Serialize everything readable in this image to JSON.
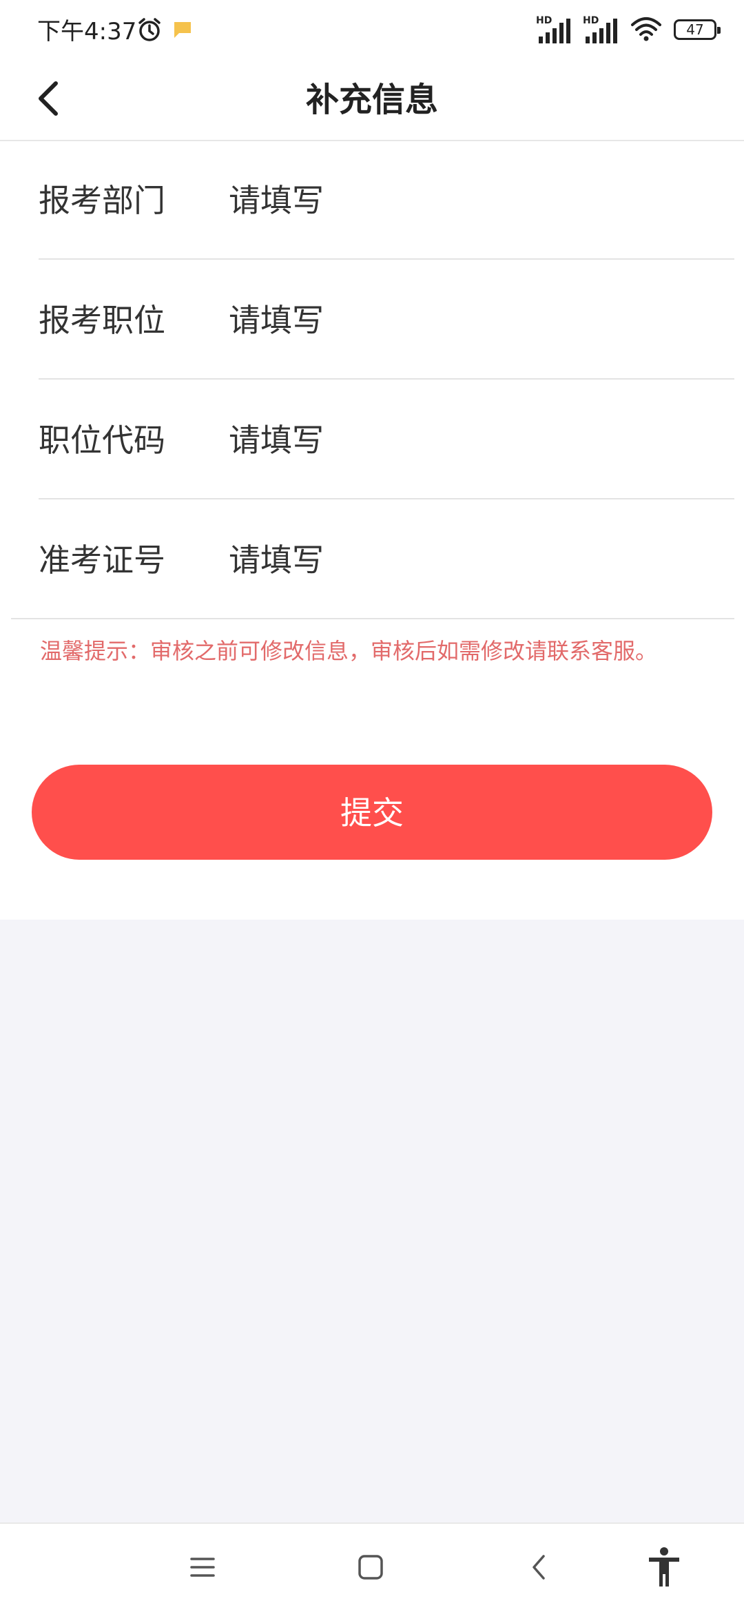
{
  "status_bar": {
    "time": "下午4:37",
    "battery": "47",
    "signal_1": "HD",
    "signal_2": "HD"
  },
  "header": {
    "title": "补充信息"
  },
  "form": {
    "fields": [
      {
        "label": "报考部门",
        "placeholder": "请填写"
      },
      {
        "label": "报考职位",
        "placeholder": "请填写"
      },
      {
        "label": "职位代码",
        "placeholder": "请填写"
      },
      {
        "label": "准考证号",
        "placeholder": "请填写"
      }
    ],
    "tip": "温馨提示：审核之前可修改信息，审核后如需修改请联系客服。",
    "submit_label": "提交"
  },
  "colors": {
    "accent": "#ff4f4c",
    "tip": "#e26a6a",
    "background": "#f4f4f9"
  }
}
